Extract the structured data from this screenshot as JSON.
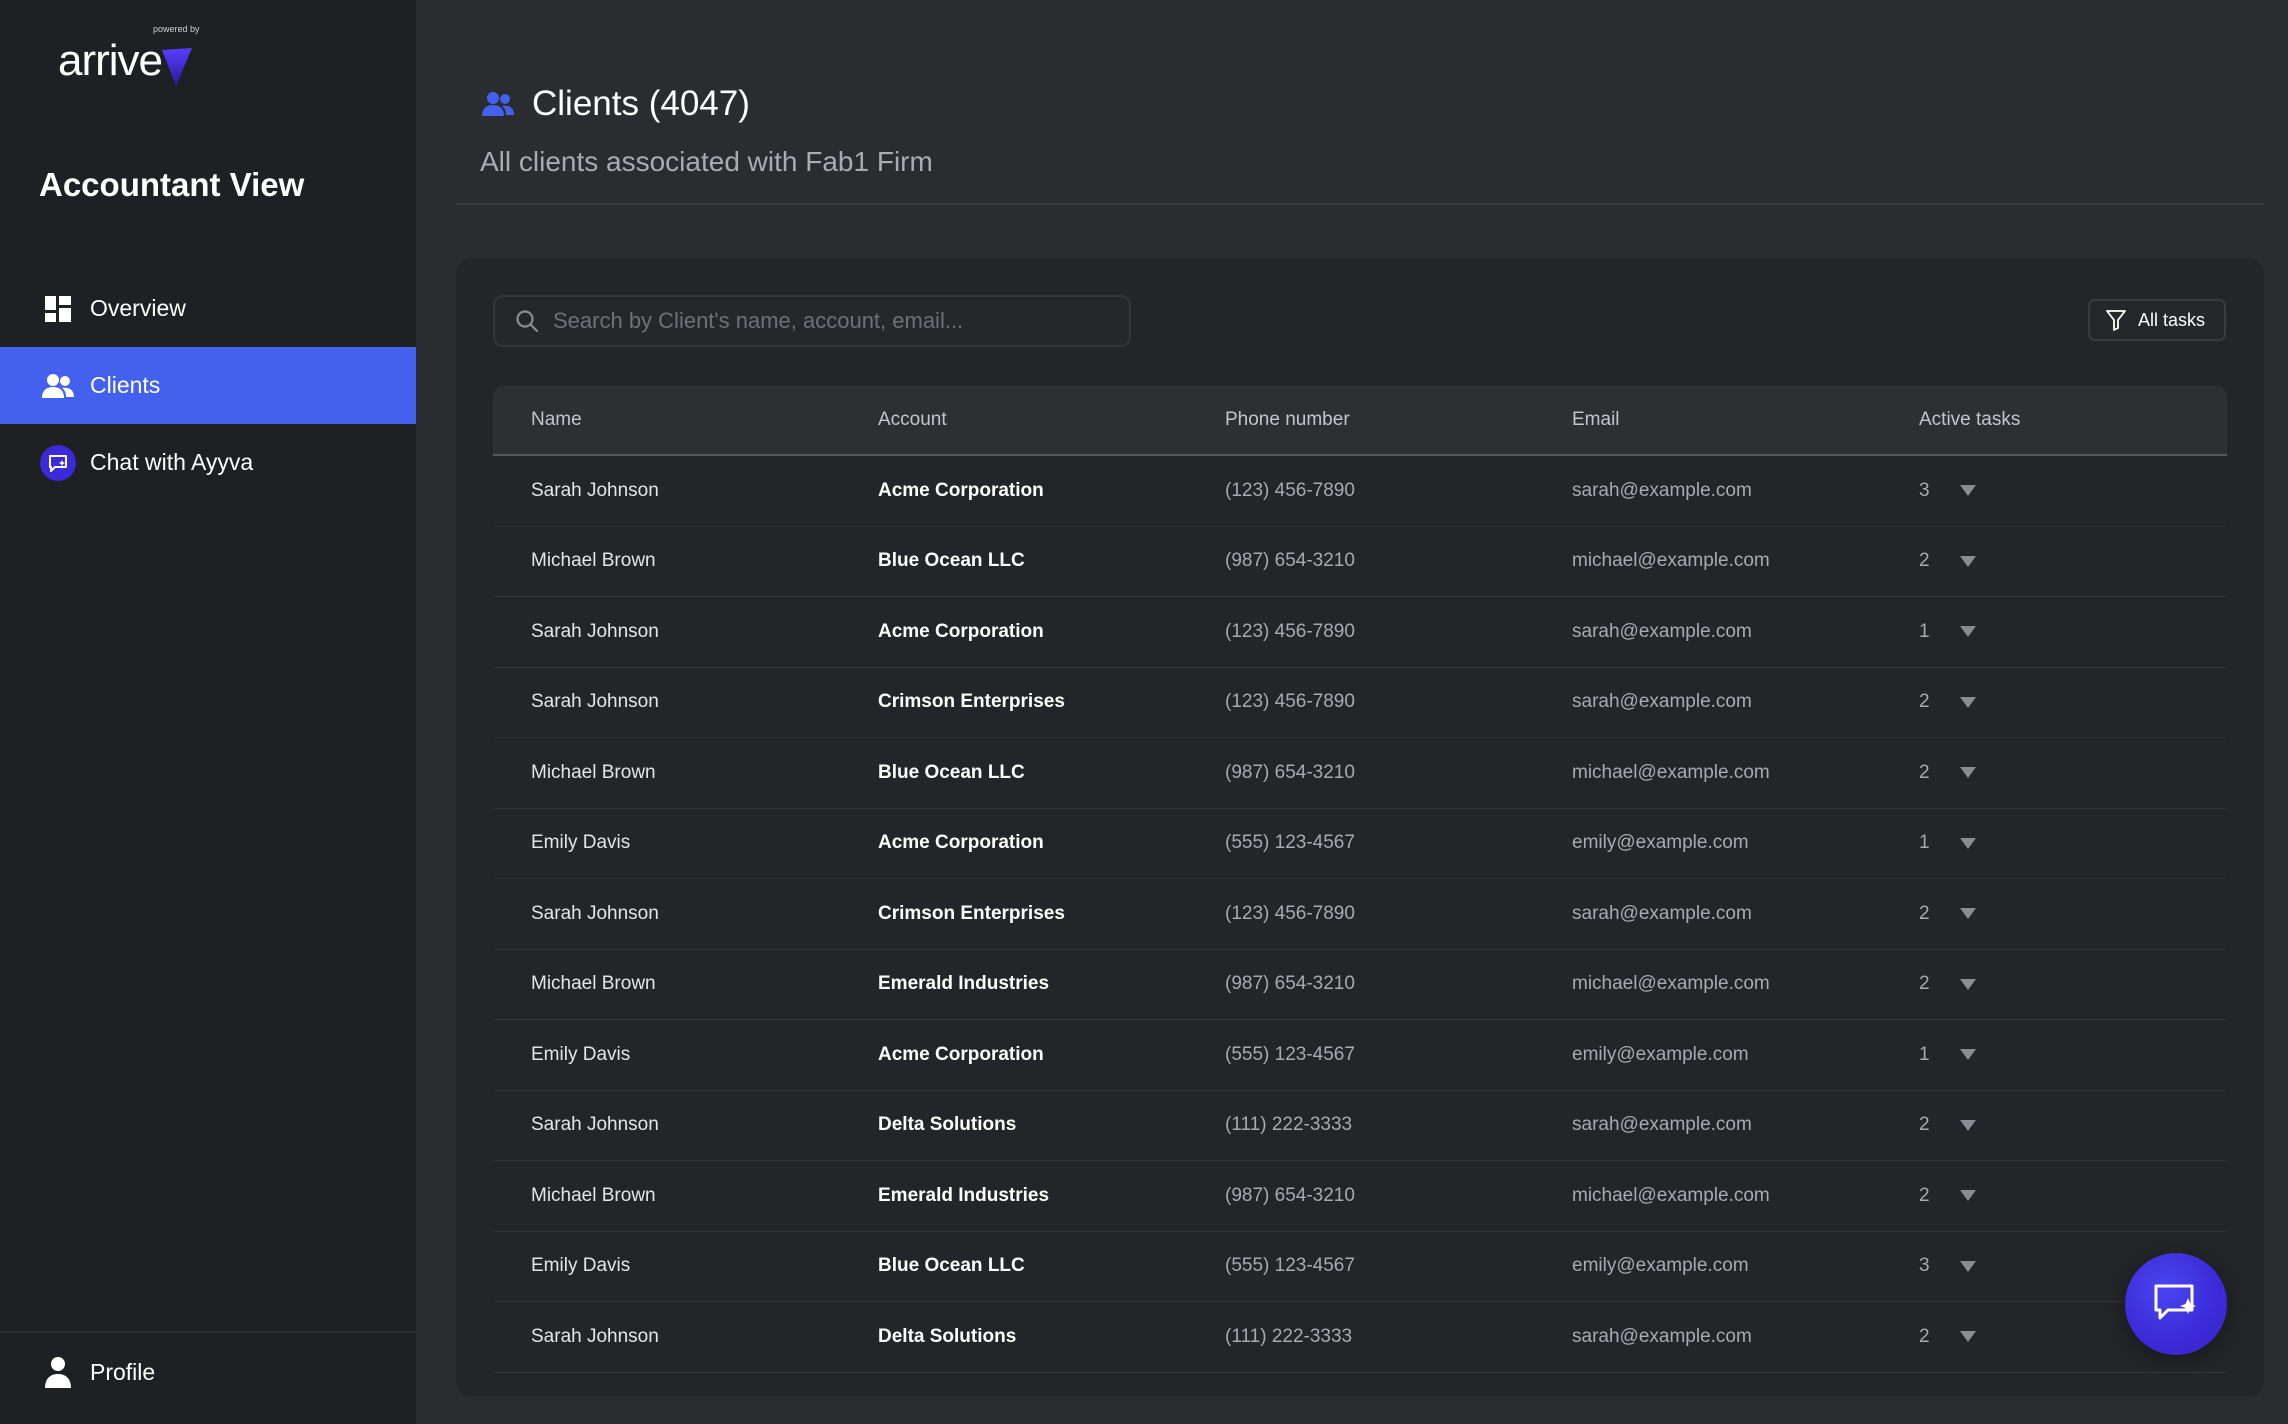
{
  "brand": {
    "powered_by": "powered by",
    "name": "arrive"
  },
  "sidebar": {
    "view_title": "Accountant View",
    "items": [
      {
        "label": "Overview",
        "icon": "dashboard-icon",
        "active": false
      },
      {
        "label": "Clients",
        "icon": "users-icon",
        "active": true
      },
      {
        "label": "Chat with Ayyva",
        "icon": "chat-assistant-icon",
        "active": false
      }
    ],
    "profile_label": "Profile"
  },
  "header": {
    "title": "Clients (4047)",
    "subtitle": "All clients associated with Fab1 Firm"
  },
  "search": {
    "placeholder": "Search by Client's name, account, email..."
  },
  "filter": {
    "label": "All tasks"
  },
  "table": {
    "columns": [
      "Name",
      "Account",
      "Phone number",
      "Email",
      "Active tasks"
    ],
    "rows": [
      {
        "name": "Sarah Johnson",
        "account": "Acme Corporation",
        "phone": "(123) 456-7890",
        "email": "sarah@example.com",
        "tasks": "3"
      },
      {
        "name": "Michael Brown",
        "account": "Blue Ocean LLC",
        "phone": "(987) 654-3210",
        "email": "michael@example.com",
        "tasks": "2"
      },
      {
        "name": "Sarah Johnson",
        "account": "Acme Corporation",
        "phone": "(123) 456-7890",
        "email": "sarah@example.com",
        "tasks": "1"
      },
      {
        "name": "Sarah Johnson",
        "account": "Crimson Enterprises",
        "phone": "(123) 456-7890",
        "email": "sarah@example.com",
        "tasks": "2"
      },
      {
        "name": "Michael Brown",
        "account": "Blue Ocean LLC",
        "phone": "(987) 654-3210",
        "email": "michael@example.com",
        "tasks": "2"
      },
      {
        "name": "Emily Davis",
        "account": "Acme Corporation",
        "phone": "(555) 123-4567",
        "email": "emily@example.com",
        "tasks": "1"
      },
      {
        "name": "Sarah Johnson",
        "account": "Crimson Enterprises",
        "phone": "(123) 456-7890",
        "email": "sarah@example.com",
        "tasks": "2"
      },
      {
        "name": "Michael Brown",
        "account": "Emerald Industries",
        "phone": "(987) 654-3210",
        "email": "michael@example.com",
        "tasks": "2"
      },
      {
        "name": "Emily Davis",
        "account": "Acme Corporation",
        "phone": "(555) 123-4567",
        "email": "emily@example.com",
        "tasks": "1"
      },
      {
        "name": "Sarah Johnson",
        "account": "Delta Solutions",
        "phone": "(111) 222-3333",
        "email": "sarah@example.com",
        "tasks": "2"
      },
      {
        "name": "Michael Brown",
        "account": "Emerald Industries",
        "phone": "(987) 654-3210",
        "email": "michael@example.com",
        "tasks": "2"
      },
      {
        "name": "Emily Davis",
        "account": "Blue Ocean LLC",
        "phone": "(555) 123-4567",
        "email": "emily@example.com",
        "tasks": "3"
      },
      {
        "name": "Sarah Johnson",
        "account": "Delta Solutions",
        "phone": "(111) 222-3333",
        "email": "sarah@example.com",
        "tasks": "2"
      }
    ]
  },
  "colors": {
    "accent": "#4361ee",
    "sidebar_bg": "#1f2023",
    "main_bg": "#2b2c30",
    "card_bg": "#242528",
    "fab": "#3b2ad8"
  },
  "fab": {
    "icon": "chat-sparkle-icon"
  }
}
